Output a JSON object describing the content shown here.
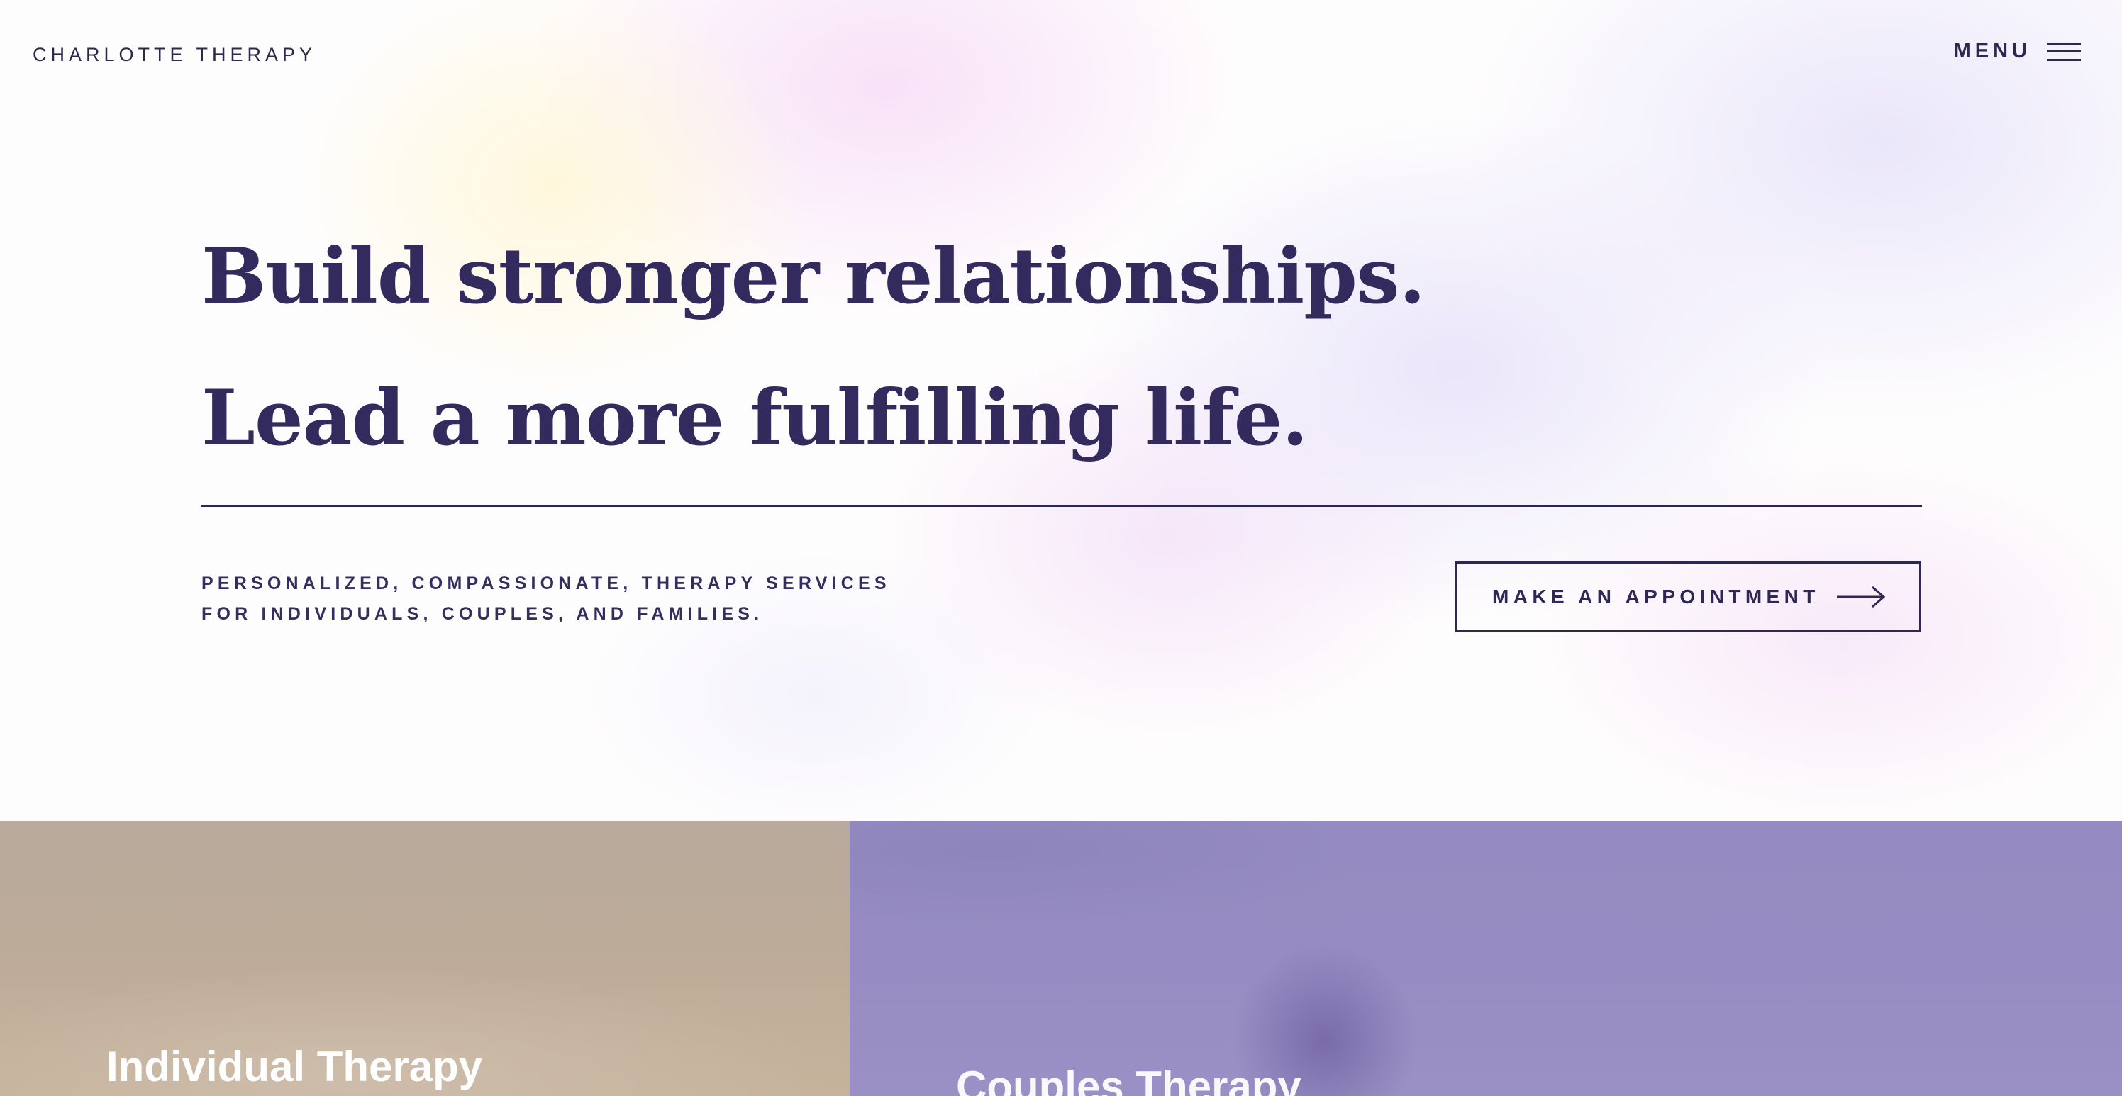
{
  "header": {
    "brand": "CHARLOTTE THERAPY",
    "menu_label": "MENU",
    "menu_icon": "hamburger-icon"
  },
  "hero": {
    "headline_line1": "Build stronger relationships.",
    "headline_line2": "Lead a more fulfilling life.",
    "tagline_line1": "PERSONALIZED, COMPASSIONATE, THERAPY SERVICES",
    "tagline_line2": "FOR INDIVIDUALS, COUPLES, AND FAMILIES.",
    "cta_label": "MAKE AN APPOINTMENT",
    "cta_icon": "arrow-right-icon"
  },
  "services": [
    {
      "title": "Individual Therapy"
    },
    {
      "title": "Couples Therapy"
    }
  ],
  "colors": {
    "primary_text": "#332a5d",
    "individual_card": "#b8aa9c",
    "couples_card": "#958bc2"
  }
}
